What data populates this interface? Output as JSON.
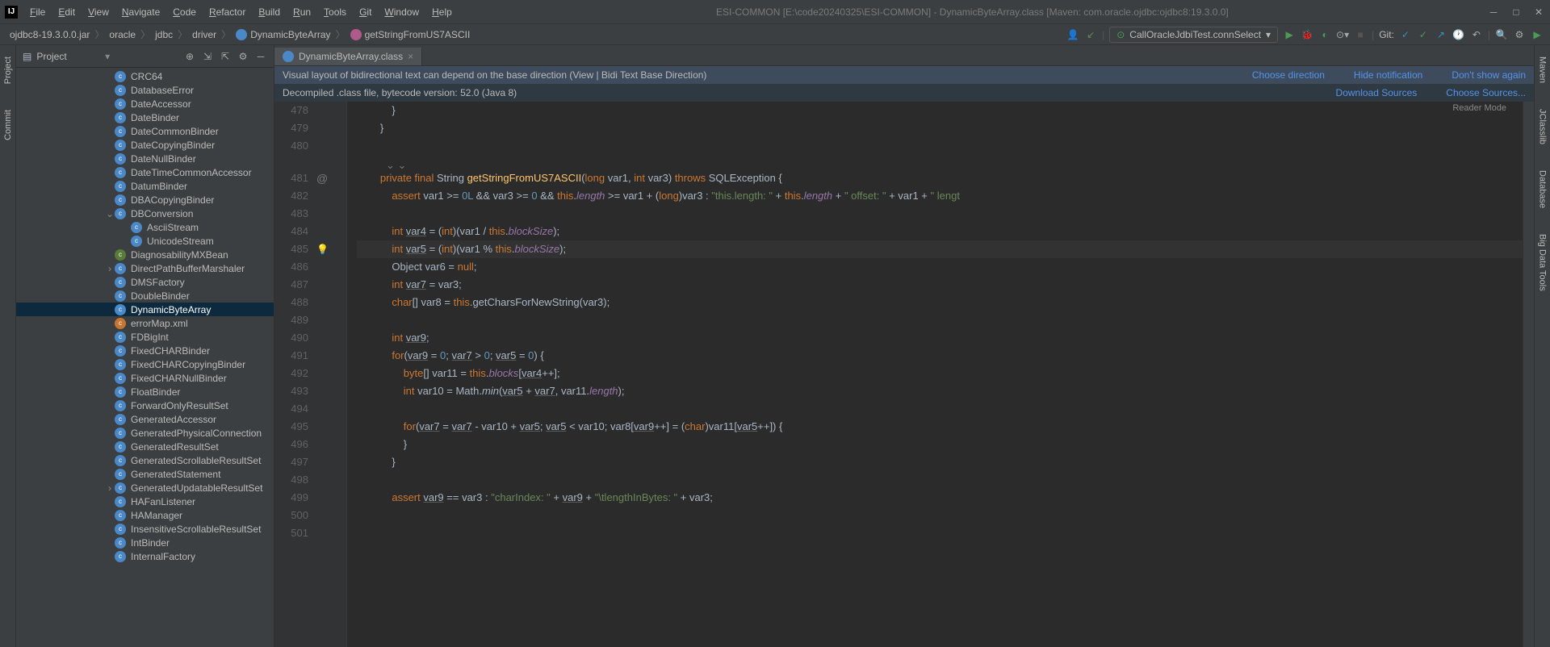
{
  "title": "ESI-COMMON [E:\\code20240325\\ESI-COMMON] - DynamicByteArray.class [Maven: com.oracle.ojdbc:ojdbc8:19.3.0.0]",
  "menu": [
    "File",
    "Edit",
    "View",
    "Navigate",
    "Code",
    "Refactor",
    "Build",
    "Run",
    "Tools",
    "Git",
    "Window",
    "Help"
  ],
  "breadcrumbs": [
    "ojdbc8-19.3.0.0.jar",
    "oracle",
    "jdbc",
    "driver",
    "DynamicByteArray",
    "getStringFromUS7ASCII"
  ],
  "run_config": "CallOracleJdbiTest.connSelect",
  "git_label": "Git:",
  "panel": {
    "title": "Project"
  },
  "left_tabs": [
    "Project",
    "Commit"
  ],
  "right_tabs": [
    "Maven",
    "JClasslib",
    "Database",
    "Big Data Tools"
  ],
  "tree": [
    {
      "ind": 128,
      "t": "CRC64"
    },
    {
      "ind": 128,
      "t": "DatabaseError"
    },
    {
      "ind": 128,
      "t": "DateAccessor"
    },
    {
      "ind": 128,
      "t": "DateBinder"
    },
    {
      "ind": 128,
      "t": "DateCommonBinder"
    },
    {
      "ind": 128,
      "t": "DateCopyingBinder"
    },
    {
      "ind": 128,
      "t": "DateNullBinder"
    },
    {
      "ind": 128,
      "t": "DateTimeCommonAccessor"
    },
    {
      "ind": 128,
      "t": "DatumBinder"
    },
    {
      "ind": 128,
      "t": "DBACopyingBinder"
    },
    {
      "ind": 128,
      "t": "DBConversion",
      "exp": "v"
    },
    {
      "ind": 148,
      "t": "AsciiStream"
    },
    {
      "ind": 148,
      "t": "UnicodeStream"
    },
    {
      "ind": 128,
      "t": "DiagnosabilityMXBean",
      "ico": "int"
    },
    {
      "ind": 128,
      "t": "DirectPathBufferMarshaler",
      "exp": ">"
    },
    {
      "ind": 128,
      "t": "DMSFactory"
    },
    {
      "ind": 128,
      "t": "DoubleBinder"
    },
    {
      "ind": 128,
      "t": "DynamicByteArray",
      "sel": true
    },
    {
      "ind": 128,
      "t": "errorMap.xml",
      "ico": "orange"
    },
    {
      "ind": 128,
      "t": "FDBigInt"
    },
    {
      "ind": 128,
      "t": "FixedCHARBinder"
    },
    {
      "ind": 128,
      "t": "FixedCHARCopyingBinder"
    },
    {
      "ind": 128,
      "t": "FixedCHARNullBinder"
    },
    {
      "ind": 128,
      "t": "FloatBinder"
    },
    {
      "ind": 128,
      "t": "ForwardOnlyResultSet"
    },
    {
      "ind": 128,
      "t": "GeneratedAccessor"
    },
    {
      "ind": 128,
      "t": "GeneratedPhysicalConnection"
    },
    {
      "ind": 128,
      "t": "GeneratedResultSet"
    },
    {
      "ind": 128,
      "t": "GeneratedScrollableResultSet"
    },
    {
      "ind": 128,
      "t": "GeneratedStatement"
    },
    {
      "ind": 128,
      "t": "GeneratedUpdatableResultSet",
      "exp": ">"
    },
    {
      "ind": 128,
      "t": "HAFanListener"
    },
    {
      "ind": 128,
      "t": "HAManager"
    },
    {
      "ind": 128,
      "t": "InsensitiveScrollableResultSet"
    },
    {
      "ind": 128,
      "t": "IntBinder"
    },
    {
      "ind": 128,
      "t": "InternalFactory"
    }
  ],
  "tab_name": "DynamicByteArray.class",
  "banner1": {
    "text": "Visual layout of bidirectional text can depend on the base direction (View | Bidi Text Base Direction)",
    "links": [
      "Choose direction",
      "Hide notification",
      "Don't show again"
    ]
  },
  "banner2": {
    "text": "Decompiled .class file, bytecode version: 52.0 (Java 8)",
    "links": [
      "Download Sources",
      "Choose Sources..."
    ]
  },
  "reader_mode": "Reader Mode",
  "line_start": 478,
  "line_end": 501,
  "code_lines": [
    {
      "n": 478,
      "html": "            }"
    },
    {
      "n": 479,
      "html": "        }"
    },
    {
      "n": 480,
      "html": ""
    },
    {
      "n": 481,
      "html": "        <span class='kw'>private final</span> String <span class='fn'>getStringFromUS7ASCII</span>(<span class='kw'>long</span> var1, <span class='kw'>int</span> var3) <span class='kw'>throws</span> SQLException {",
      "at": true
    },
    {
      "n": 482,
      "html": "            <span class='kw'>assert</span> var1 &gt;= <span class='num'>0L</span> &amp;&amp; var3 &gt;= <span class='num'>0</span> &amp;&amp; <span class='kw'>this</span>.<span class='fld'>length</span> &gt;= var1 + (<span class='kw'>long</span>)var3 : <span class='str'>\"this.length: \"</span> + <span class='kw'>this</span>.<span class='fld'>length</span> + <span class='str'>\" offset: \"</span> + var1 + <span class='str'>\" lengt</span>"
    },
    {
      "n": 483,
      "html": ""
    },
    {
      "n": 484,
      "html": "            <span class='kw'>int</span> <span class='var-u'>var4</span> = (<span class='kw'>int</span>)(var1 / <span class='kw'>this</span>.<span class='fld'>blockSize</span>);"
    },
    {
      "n": 485,
      "html": "            <span class='kw'>int</span> <span class='var-u'>var5</span> = (<span class='kw'>int</span>)(var1 % <span class='kw'>this</span>.<span class='fld'>blockSize</span>);",
      "hl": true,
      "bulb": true
    },
    {
      "n": 486,
      "html": "            Object var6 = <span class='kw'>null</span>;"
    },
    {
      "n": 487,
      "html": "            <span class='kw'>int</span> <span class='var-u'>var7</span> = var3;"
    },
    {
      "n": 488,
      "html": "            <span class='kw'>char</span>[] var8 = <span class='kw'>this</span>.getCharsForNewString(var3);"
    },
    {
      "n": 489,
      "html": ""
    },
    {
      "n": 490,
      "html": "            <span class='kw'>int</span> <span class='var-u'>var9</span>;"
    },
    {
      "n": 491,
      "html": "            <span class='kw'>for</span>(<span class='var-u'>var9</span> = <span class='num'>0</span>; <span class='var-u'>var7</span> &gt; <span class='num'>0</span>; <span class='var-u'>var5</span> = <span class='num'>0</span>) {"
    },
    {
      "n": 492,
      "html": "                <span class='kw'>byte</span>[] var11 = <span class='kw'>this</span>.<span class='fld'>blocks</span>[<span class='var-u'>var4</span>++];"
    },
    {
      "n": 493,
      "html": "                <span class='kw'>int</span> var10 = Math.<span style='font-style:italic'>min</span>(<span class='var-u'>var5</span> + <span class='var-u'>var7</span>, var11.<span class='fld'>length</span>);"
    },
    {
      "n": 494,
      "html": ""
    },
    {
      "n": 495,
      "html": "                <span class='kw'>for</span>(<span class='var-u'>var7</span> = <span class='var-u'>var7</span> - var10 + <span class='var-u'>var5</span>; <span class='var-u'>var5</span> &lt; var10; var8[<span class='var-u'>var9</span>++] = (<span class='kw'>char</span>)var11[<span class='var-u'>var5</span>++]) {"
    },
    {
      "n": 496,
      "html": "                }"
    },
    {
      "n": 497,
      "html": "            }"
    },
    {
      "n": 498,
      "html": ""
    },
    {
      "n": 499,
      "html": "            <span class='kw'>assert</span> <span class='var-u'>var9</span> == var3 : <span class='str'>\"charIndex: \"</span> + <span class='var-u'>var9</span> + <span class='str'>\"\\tlengthInBytes: \"</span> + var3;"
    },
    {
      "n": 500,
      "html": ""
    },
    {
      "n": 501,
      "html": ""
    }
  ],
  "chart_data": null
}
